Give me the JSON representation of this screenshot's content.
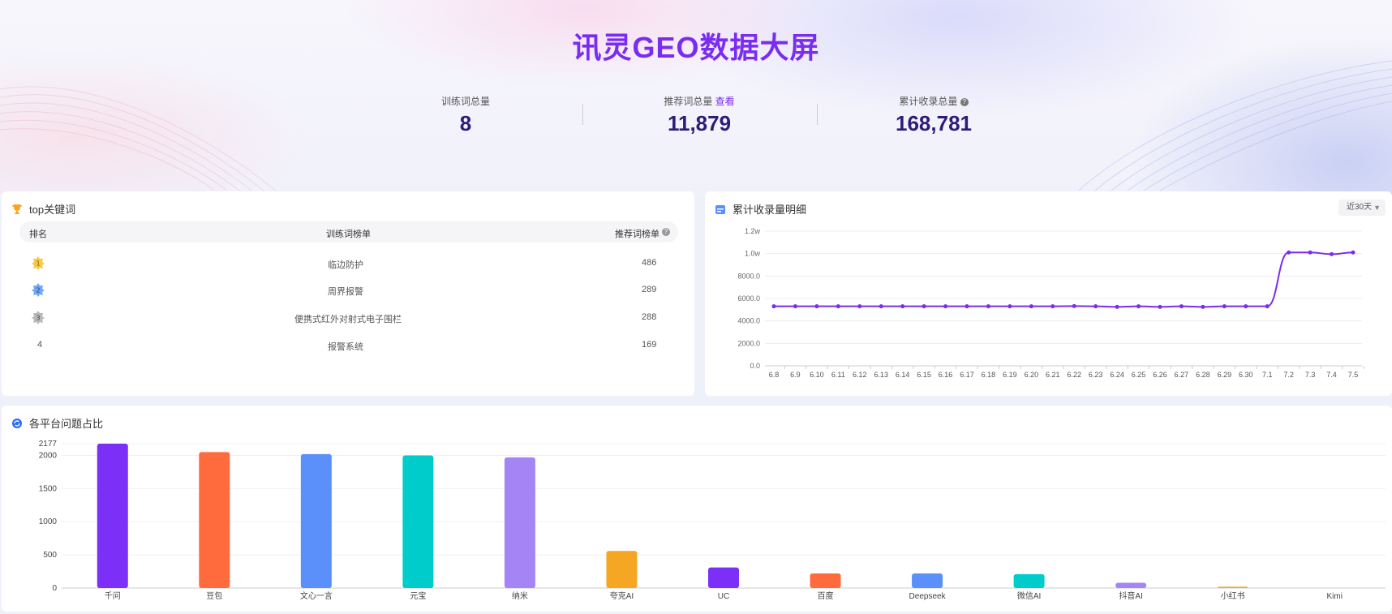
{
  "title": "讯灵GEO数据大屏",
  "stats": [
    {
      "label": "训练词总量",
      "value": "8"
    },
    {
      "label": "推荐词总量",
      "link": "查看",
      "value": "11,879"
    },
    {
      "label": "累计收录总量",
      "help": "?",
      "value": "168,781"
    }
  ],
  "top_keywords": {
    "title": "top关键词",
    "headers": {
      "rank": "排名",
      "train": "训练词榜单",
      "recommend": "推荐词榜单",
      "help": "?"
    },
    "rows": [
      {
        "rank": "1",
        "word": "临边防护",
        "count": "486"
      },
      {
        "rank": "2",
        "word": "周界报警",
        "count": "289"
      },
      {
        "rank": "3",
        "word": "便携式红外对射式电子围栏",
        "count": "288"
      },
      {
        "rank": "4",
        "word": "报警系统",
        "count": "169"
      }
    ]
  },
  "trend": {
    "title": "累计收录量明细",
    "range_label": "近30天",
    "colors": {
      "line": "#7a2cf0"
    }
  },
  "platform": {
    "title": "各平台问题占比"
  },
  "chart_data": [
    {
      "type": "line",
      "title": "累计收录量明细",
      "x": [
        "6.8",
        "6.9",
        "6.10",
        "6.11",
        "6.12",
        "6.13",
        "6.14",
        "6.15",
        "6.16",
        "6.17",
        "6.18",
        "6.19",
        "6.20",
        "6.21",
        "6.22",
        "6.23",
        "6.24",
        "6.25",
        "6.26",
        "6.27",
        "6.28",
        "6.29",
        "6.30",
        "7.1",
        "7.2",
        "7.3",
        "7.4",
        "7.5"
      ],
      "series": [
        {
          "values": [
            5300,
            5300,
            5300,
            5300,
            5300,
            5300,
            5300,
            5300,
            5300,
            5300,
            5300,
            5300,
            5300,
            5300,
            5320,
            5300,
            5250,
            5300,
            5250,
            5300,
            5250,
            5300,
            5300,
            5300,
            10100,
            10100,
            9950,
            10100
          ]
        }
      ],
      "yticks": [
        "0.0",
        "2000.0",
        "4000.0",
        "6000.0",
        "8000.0",
        "1.0w",
        "1.2w"
      ],
      "ylim": [
        0,
        12000
      ],
      "grid": true
    },
    {
      "type": "bar",
      "title": "各平台问题占比",
      "categories": [
        "千问",
        "豆包",
        "文心一言",
        "元宝",
        "纳米",
        "夸克AI",
        "UC",
        "百度",
        "Deepseek",
        "微信AI",
        "抖音AI",
        "小红书",
        "Kimi"
      ],
      "values": [
        2177,
        2050,
        2020,
        2000,
        1970,
        560,
        310,
        220,
        220,
        210,
        80,
        20,
        0
      ],
      "colors": [
        "#7b2ff7",
        "#ff6b3d",
        "#5b8ff9",
        "#00cccc",
        "#a585f5",
        "#f5a623",
        "#7b2ff7",
        "#ff6b3d",
        "#5b8ff9",
        "#00cccc",
        "#a585f5",
        "#f5a623",
        "#7b2ff7"
      ],
      "yticks": [
        "0",
        "500",
        "1000",
        "1500",
        "2000",
        "2177"
      ],
      "ylim": [
        0,
        2177
      ],
      "grid": true
    }
  ]
}
